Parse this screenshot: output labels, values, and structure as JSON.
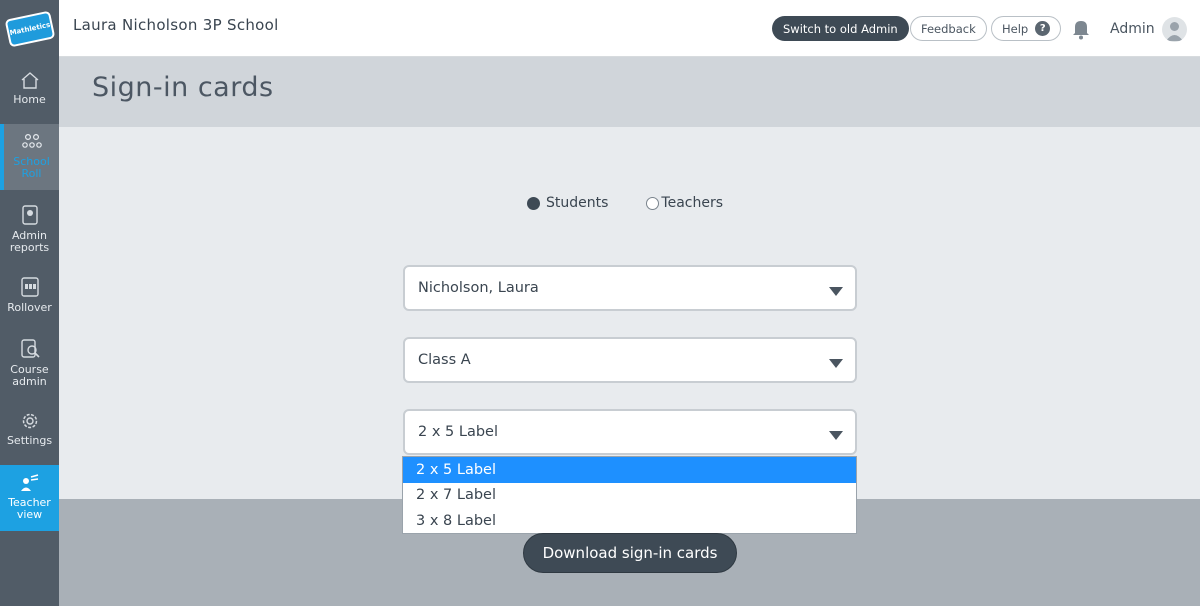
{
  "sidebar": {
    "logo_text": "Mathletics",
    "items": [
      {
        "label": "Home",
        "icon": "home-icon"
      },
      {
        "label": "School Roll",
        "icon": "people-icon"
      },
      {
        "label": "Admin reports",
        "icon": "report-icon"
      },
      {
        "label": "Rollover",
        "icon": "rollover-icon"
      },
      {
        "label": "Course admin",
        "icon": "course-icon"
      },
      {
        "label": "Settings",
        "icon": "gear-icon"
      },
      {
        "label": "Teacher view",
        "icon": "teacher-icon"
      }
    ],
    "active_index": 1
  },
  "header": {
    "school_name": "Laura Nicholson 3P School",
    "switch_label": "Switch to old Admin",
    "feedback_label": "Feedback",
    "help_label": "Help",
    "admin_label": "Admin"
  },
  "page": {
    "title": "Sign-in cards"
  },
  "form": {
    "radio_options": [
      {
        "label": "Students",
        "checked": true
      },
      {
        "label": "Teachers",
        "checked": false
      }
    ],
    "teacher_select": "Nicholson, Laura",
    "class_select": "Class A",
    "label_select": "2 x 5 Label",
    "label_options": [
      "2 x 5 Label",
      "2 x 7 Label",
      "3 x 8 Label"
    ],
    "selected_label_index": 0,
    "download_label": "Download sign-in cards"
  },
  "colors": {
    "accent": "#1da1e2",
    "dark": "#3e4a55",
    "sidebar": "#515c67",
    "highlight": "#1e90ff"
  }
}
